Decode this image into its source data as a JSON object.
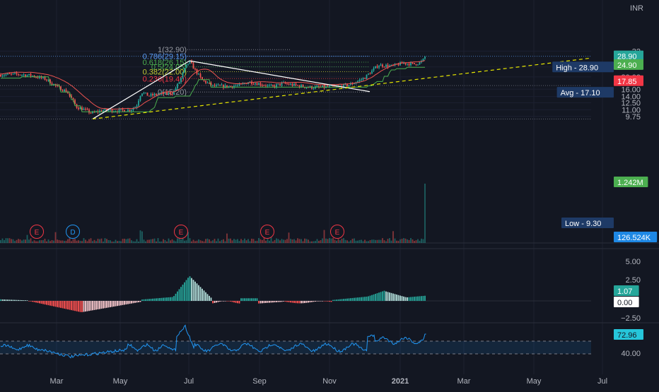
{
  "currency": "INR",
  "price_panel": {
    "ticks": [
      "32",
      "24.00",
      "20.00",
      "16.00",
      "14.00",
      "12.50",
      "11.00",
      "9.75"
    ],
    "fib_levels": [
      {
        "label": "1(32.90)",
        "price": 32.9,
        "color": "#9598a1"
      },
      {
        "label": "0.786(29.15)",
        "price": 29.15,
        "color": "#5b9cf6"
      },
      {
        "label": "0.618(26.15)",
        "price": 26.15,
        "color": "#4caf50"
      },
      {
        "label": "0.5(24.05)",
        "price": 24.05,
        "color": "#4caf50"
      },
      {
        "label": "0.382(22.00)",
        "price": 22.0,
        "color": "#c0ca33"
      },
      {
        "label": "0.236(19.40)",
        "price": 19.4,
        "color": "#f23645"
      },
      {
        "label": "0(15.20)",
        "price": 15.2,
        "color": "#9598a1"
      }
    ],
    "badges": {
      "last": "28.90",
      "high": "High - 28.90",
      "green_level": "24.90",
      "red_level": "17.85",
      "avg": "Avg - 17.10",
      "volume": "1.242M",
      "low": "Low - 9.30",
      "volume_ma": "126.524K"
    },
    "event_markers": [
      "E",
      "D",
      "E",
      "E",
      "E"
    ],
    "high": 28.9,
    "low": 9.3,
    "avg": 17.1
  },
  "macd_panel": {
    "ticks": [
      "5.00",
      "2.50",
      "−2.50"
    ],
    "badges": {
      "histogram": "1.07",
      "zero": "0.00"
    }
  },
  "rsi_panel": {
    "ticks": [
      "40.00"
    ],
    "badges": {
      "rsi": "72.96"
    }
  },
  "time_axis": [
    "Mar",
    "May",
    "Jul",
    "Sep",
    "Nov",
    "2021",
    "Mar",
    "May",
    "Jul"
  ],
  "chart_data": {
    "type": "candlestick",
    "approximate_close_path": {
      "x": [
        "Feb",
        "Mar",
        "Apr",
        "May",
        "Jun",
        "Jul",
        "Aug",
        "Sep",
        "Oct",
        "Nov",
        "Dec",
        "Jan"
      ],
      "close": [
        20.5,
        16.5,
        11.0,
        10.5,
        15.0,
        26.5,
        17.0,
        18.0,
        16.5,
        17.0,
        25.0,
        28.9
      ]
    },
    "price_axis": {
      "scale": "log",
      "range": [
        9.3,
        32.9
      ]
    },
    "swing_points": {
      "low": {
        "date": "Apr",
        "price": 9.3
      },
      "high": {
        "date": "Jul",
        "price": 26.5
      }
    },
    "indicators": [
      "Volume",
      "MACD",
      "RSI"
    ],
    "rsi_band": [
      40,
      60
    ]
  },
  "colors": {
    "background": "#131722",
    "up": "#26a69a",
    "down": "#ef5350",
    "trendline_dashed": "#e6e600",
    "lines": "#ffffff",
    "rsi_line": "#2196f3"
  }
}
